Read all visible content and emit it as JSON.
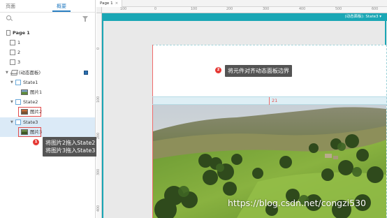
{
  "left_panel": {
    "tabs": {
      "pages": "页面",
      "outline": "概要"
    },
    "tree": {
      "page1": "Page 1",
      "items": [
        {
          "label": "1"
        },
        {
          "label": "2"
        },
        {
          "label": "3"
        }
      ],
      "dynamic_panel": "(动态面板)",
      "state1": "State1",
      "image1": "图片1",
      "state2": "State2",
      "image2": "图片2",
      "state3": "State3",
      "image3": "图片3"
    },
    "callout": {
      "badge": "1",
      "line1": "将图片2拖入State2",
      "line2": "将图片3拖入State3"
    }
  },
  "canvas": {
    "doc_tab": "Page 1",
    "doc_tab_close": "×",
    "hruler_labels": [
      "100",
      "0",
      "100",
      "200",
      "300",
      "400",
      "500",
      "600"
    ],
    "vruler_labels": [
      "0",
      "100",
      "200",
      "300",
      "400"
    ],
    "state_label": "(动态面板): State3 ▾",
    "callout": {
      "badge": "2",
      "text": "将元件对齐动态面板边界"
    },
    "measure": "21",
    "watermark": "https://blog.csdn.net/congzi530"
  },
  "colors": {
    "accent": "#2b7fc3",
    "teal": "#1aa7b5",
    "callout_bg": "#545454",
    "badge_red": "#e53935",
    "guide_red": "#f06b6b"
  }
}
